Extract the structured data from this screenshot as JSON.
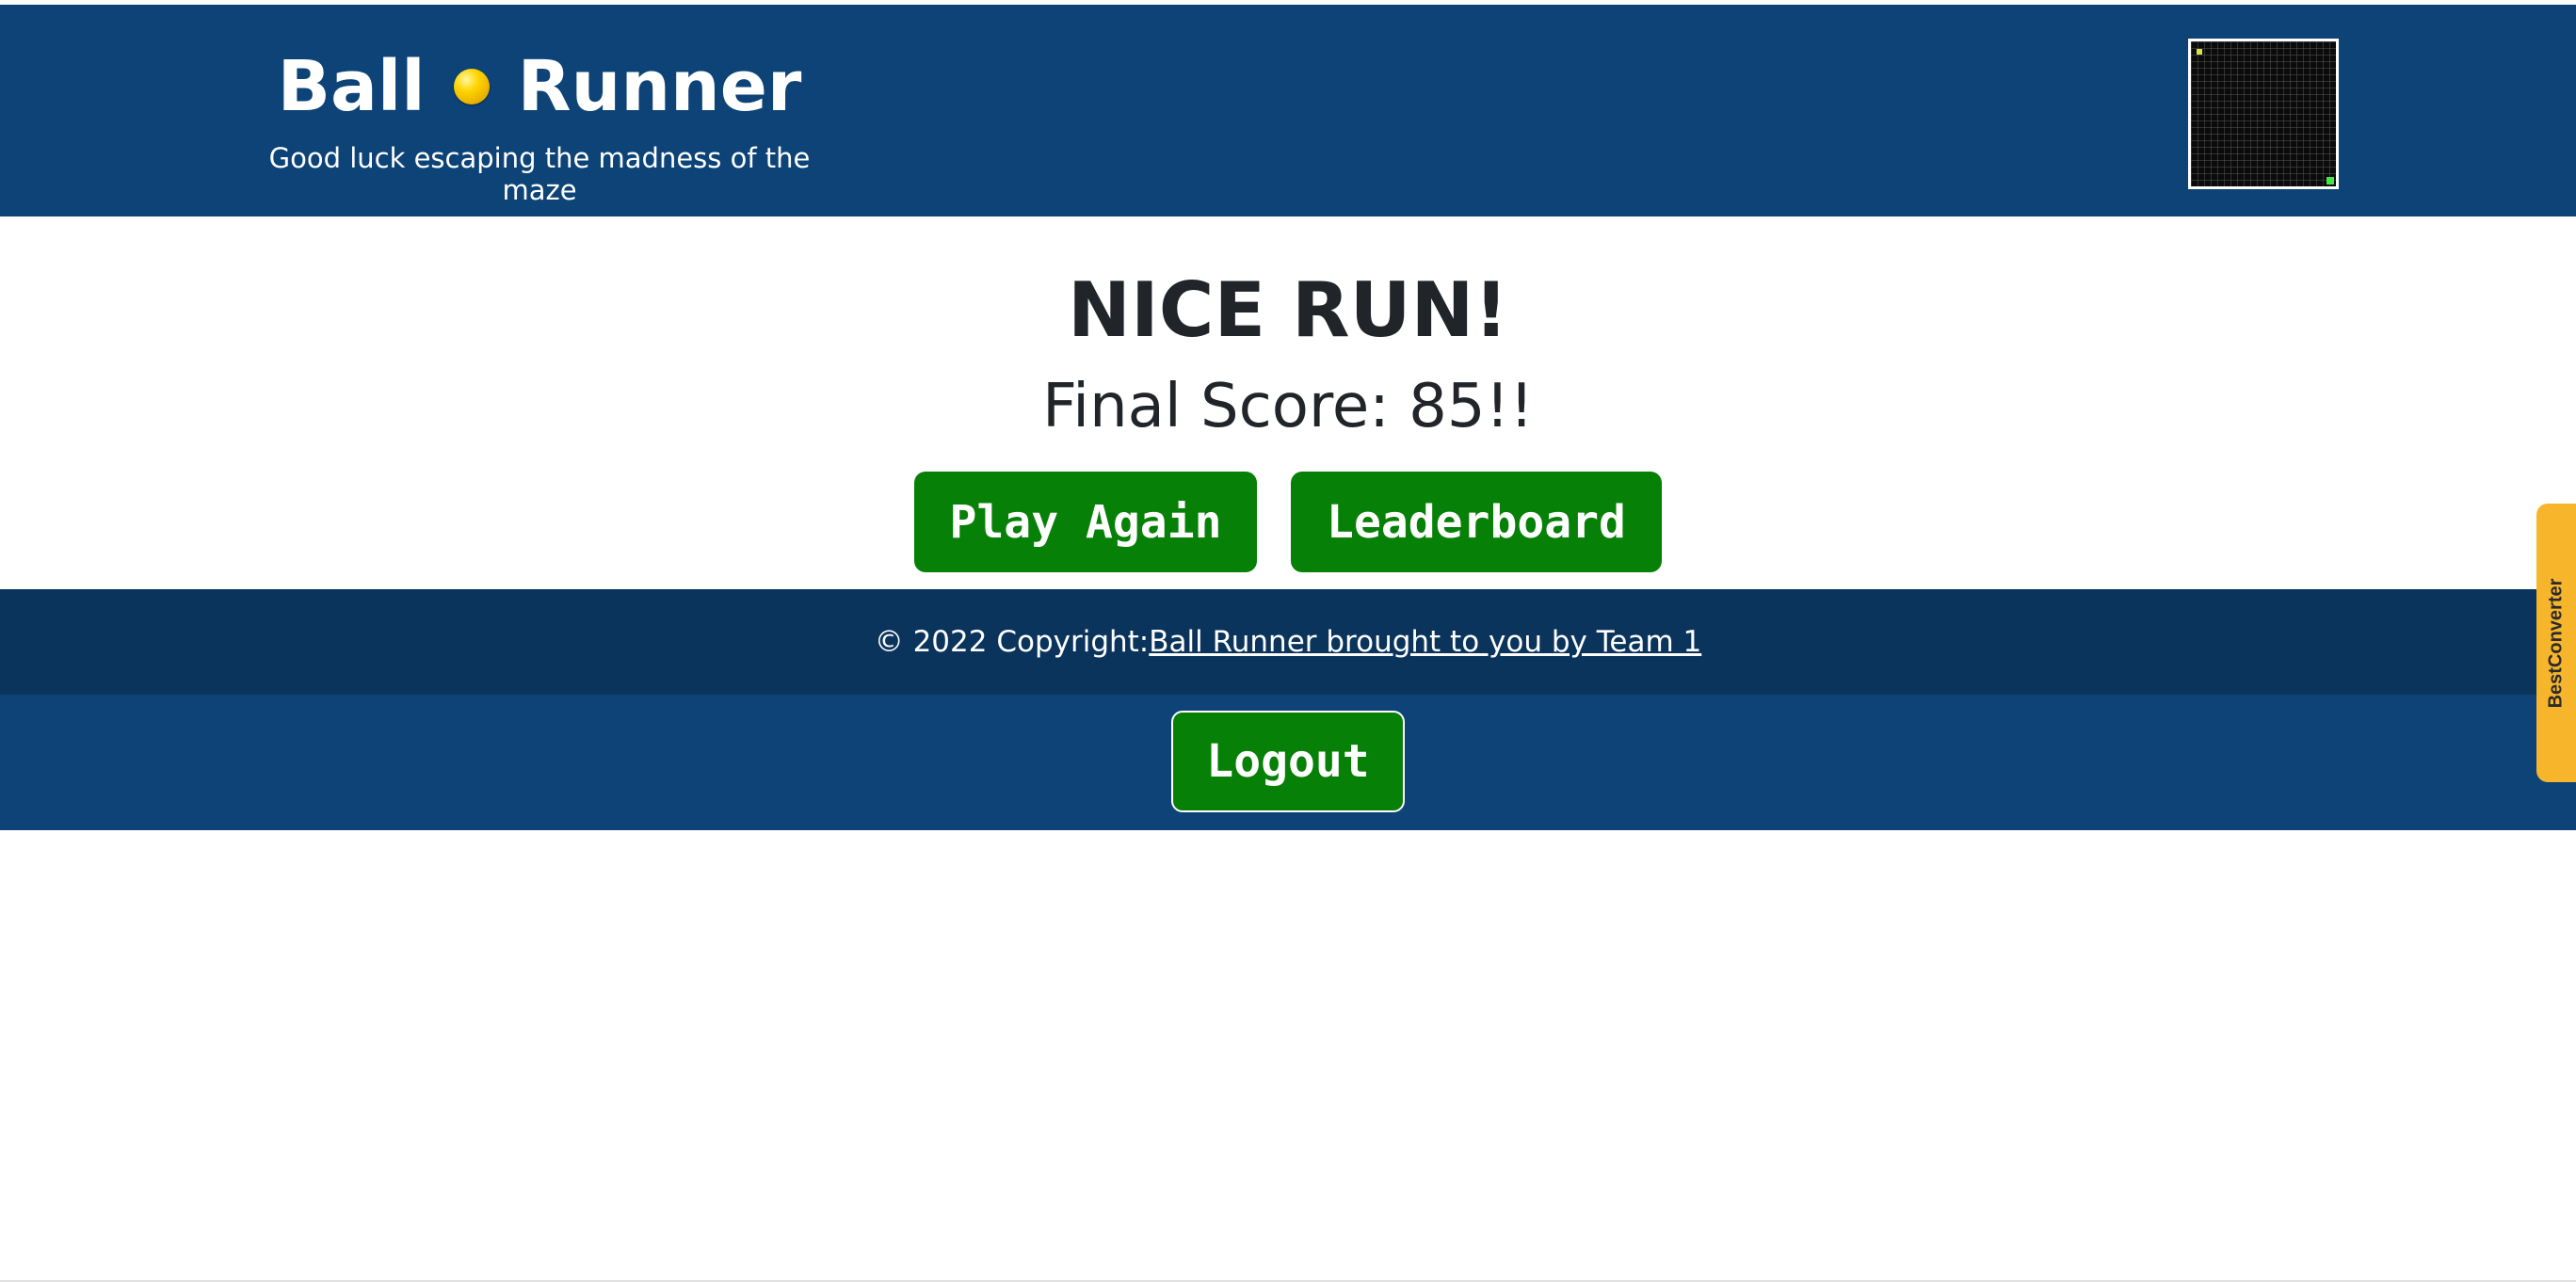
{
  "header": {
    "title_left": "Ball",
    "title_right": "Runner",
    "subtitle": "Good luck escaping the madness of the maze",
    "ball_icon": "yellow-ball-icon",
    "maze_thumbnail_icon": "maze-grid-icon"
  },
  "main": {
    "headline": "NICE RUN!",
    "final_score": "Final Score: 85!!",
    "play_again_label": "Play Again",
    "leaderboard_label": "Leaderboard"
  },
  "footer": {
    "copyright_prefix": "© 2022 Copyright:",
    "copyright_link": "Ball Runner brought to you by Team 1",
    "logout_label": "Logout"
  },
  "extension": {
    "label": "BestConverter"
  },
  "colors": {
    "header_bg": "#0d4377",
    "footer_bg": "#0b345c",
    "button_bg": "#078007",
    "ball": "#ffd400",
    "extension_tab": "#f7b52b"
  }
}
